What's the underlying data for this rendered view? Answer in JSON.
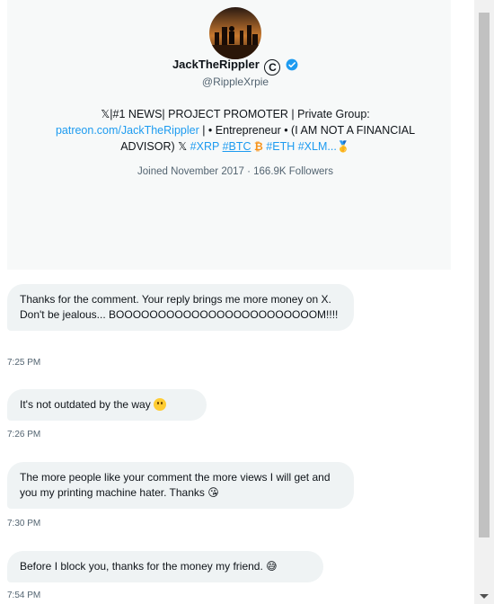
{
  "profile": {
    "name": "JackTheRippler",
    "copyright_symbol": "C",
    "handle": "@RippleXrpie",
    "bio": {
      "line1": "𝕏|#1 NEWS| PROJECT PROMOTER | Private Group:",
      "link": "patreon.com/JackTheRippler",
      "line2_rest": " | • Entrepreneur • (I AM NOT A FINANCIAL",
      "line3_prefix": "ADVISOR) 𝕏 ",
      "xrp": "#XRP",
      "btc": "#BTC",
      "btc_emoji": "₿",
      "eth": "#ETH",
      "xlm": "#XLM...",
      "medal": "🥇"
    },
    "joined": "Joined November 2017 · 166.9K Followers",
    "verified_color": "#1d9bf0"
  },
  "messages": [
    {
      "text": "Thanks for the comment. Your reply brings me more money on X. Don't be jealous... BOOOOOOOOOOOOOOOOOOOOOOOOM!!!!",
      "time": "7:25 PM"
    },
    {
      "text": "It's not outdated by the way",
      "emoji": "smile-emoji",
      "time": "7:26 PM"
    },
    {
      "text": "The more people like your comment the more views I will get and you my printing machine hater. Thanks",
      "emoji_char": "😘",
      "time": "7:30 PM"
    },
    {
      "text": "Before I block you, thanks for the money my friend.",
      "emoji_char": "😅",
      "time": "7:54 PM"
    }
  ],
  "colors": {
    "accent": "#1d9bf0",
    "bubble": "#eff3f4",
    "panel": "#f7f9f9",
    "muted": "#536471"
  }
}
